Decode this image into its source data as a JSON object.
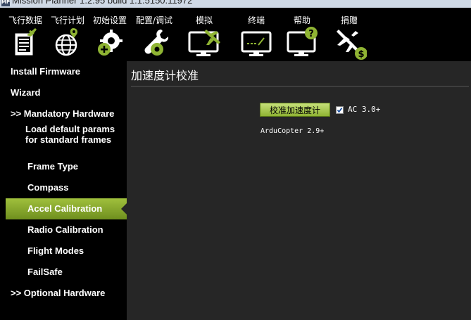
{
  "window": {
    "app_icon_text": "MP",
    "title": "Mission Planner 1.2.95 build 1.1.5150.11972"
  },
  "toolbar": {
    "items": [
      {
        "label": "飞行数据",
        "icon": "flight-data-icon"
      },
      {
        "label": "飞行计划",
        "icon": "flight-plan-icon"
      },
      {
        "label": "初始设置",
        "icon": "initial-setup-icon"
      },
      {
        "label": "配置/调试",
        "icon": "config-tuning-icon"
      },
      {
        "label": "模拟",
        "icon": "simulation-icon"
      },
      {
        "label": "终端",
        "icon": "terminal-icon"
      },
      {
        "label": "帮助",
        "icon": "help-icon"
      },
      {
        "label": "捐赠",
        "icon": "donate-icon"
      }
    ]
  },
  "sidebar": {
    "items": [
      {
        "label": "Install Firmware"
      },
      {
        "label": "Wizard"
      },
      {
        "label": ">> Mandatory Hardware"
      },
      {
        "label": "Load default params",
        "label2": "for standard frames"
      },
      {
        "label": "Frame Type"
      },
      {
        "label": "Compass"
      },
      {
        "label": "Accel Calibration",
        "active": true
      },
      {
        "label": "Radio Calibration"
      },
      {
        "label": "Flight Modes"
      },
      {
        "label": "FailSafe"
      },
      {
        "label": ">> Optional Hardware"
      }
    ]
  },
  "content": {
    "title": "加速度计校准",
    "calibrate_button": "校准加速度计",
    "ac_checkbox": {
      "label": "AC 3.0+",
      "checked": true
    },
    "version_note": "ArduCopter 2.9+"
  },
  "colors": {
    "toolbar_bg": "#000000",
    "content_bg": "#262626",
    "accent_green": "#8fb433"
  }
}
